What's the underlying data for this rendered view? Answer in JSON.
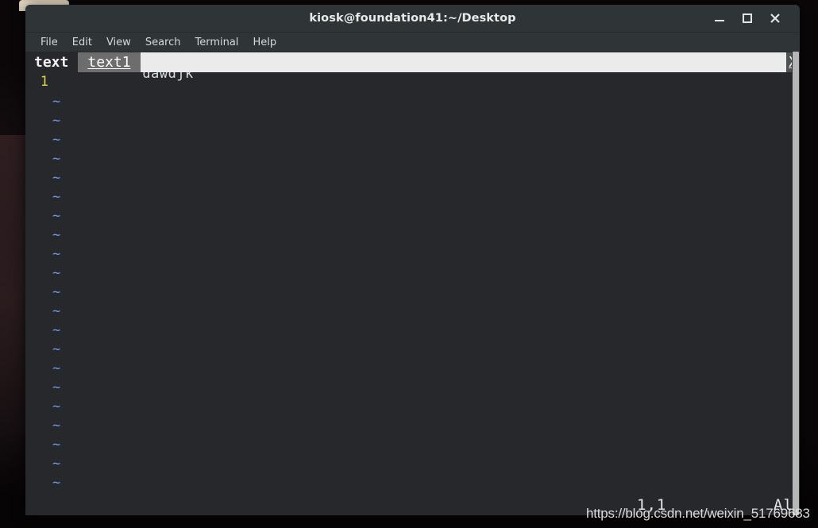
{
  "window": {
    "title": "kiosk@foundation41:~/Desktop",
    "controls": {
      "minimize_name": "minimize-button",
      "maximize_name": "maximize-button",
      "close_name": "close-button"
    }
  },
  "menubar": {
    "items": [
      {
        "label": "File"
      },
      {
        "label": "Edit"
      },
      {
        "label": "View"
      },
      {
        "label": "Search"
      },
      {
        "label": "Terminal"
      },
      {
        "label": "Help"
      }
    ]
  },
  "vim": {
    "tabline": {
      "tabs": [
        {
          "label": "text",
          "active": true
        },
        {
          "label": "text1",
          "active": false
        }
      ],
      "close_label": "X"
    },
    "buffer": {
      "lines": [
        {
          "number": "1",
          "text": "dawdjk"
        }
      ],
      "filler_char": "~",
      "filler_count": 21
    },
    "ruler": {
      "position": "1,1",
      "view": "All"
    }
  },
  "watermark": {
    "text": "https://blog.csdn.net/weixin_51769683"
  },
  "colors": {
    "desktop_bg": "#0b0709",
    "titlebar_bg": "#2f3436",
    "editor_bg": "#26282c",
    "tabline_bg": "#ebebeb",
    "tab_inactive_bg": "#6d6d6d",
    "line_number_fg": "#e0d24a",
    "tilde_fg": "#6b9ae0",
    "text_fg": "#d8dcdc",
    "scrollbar_thumb": "#b6b6b6",
    "bg_window": "#e7dac5"
  }
}
